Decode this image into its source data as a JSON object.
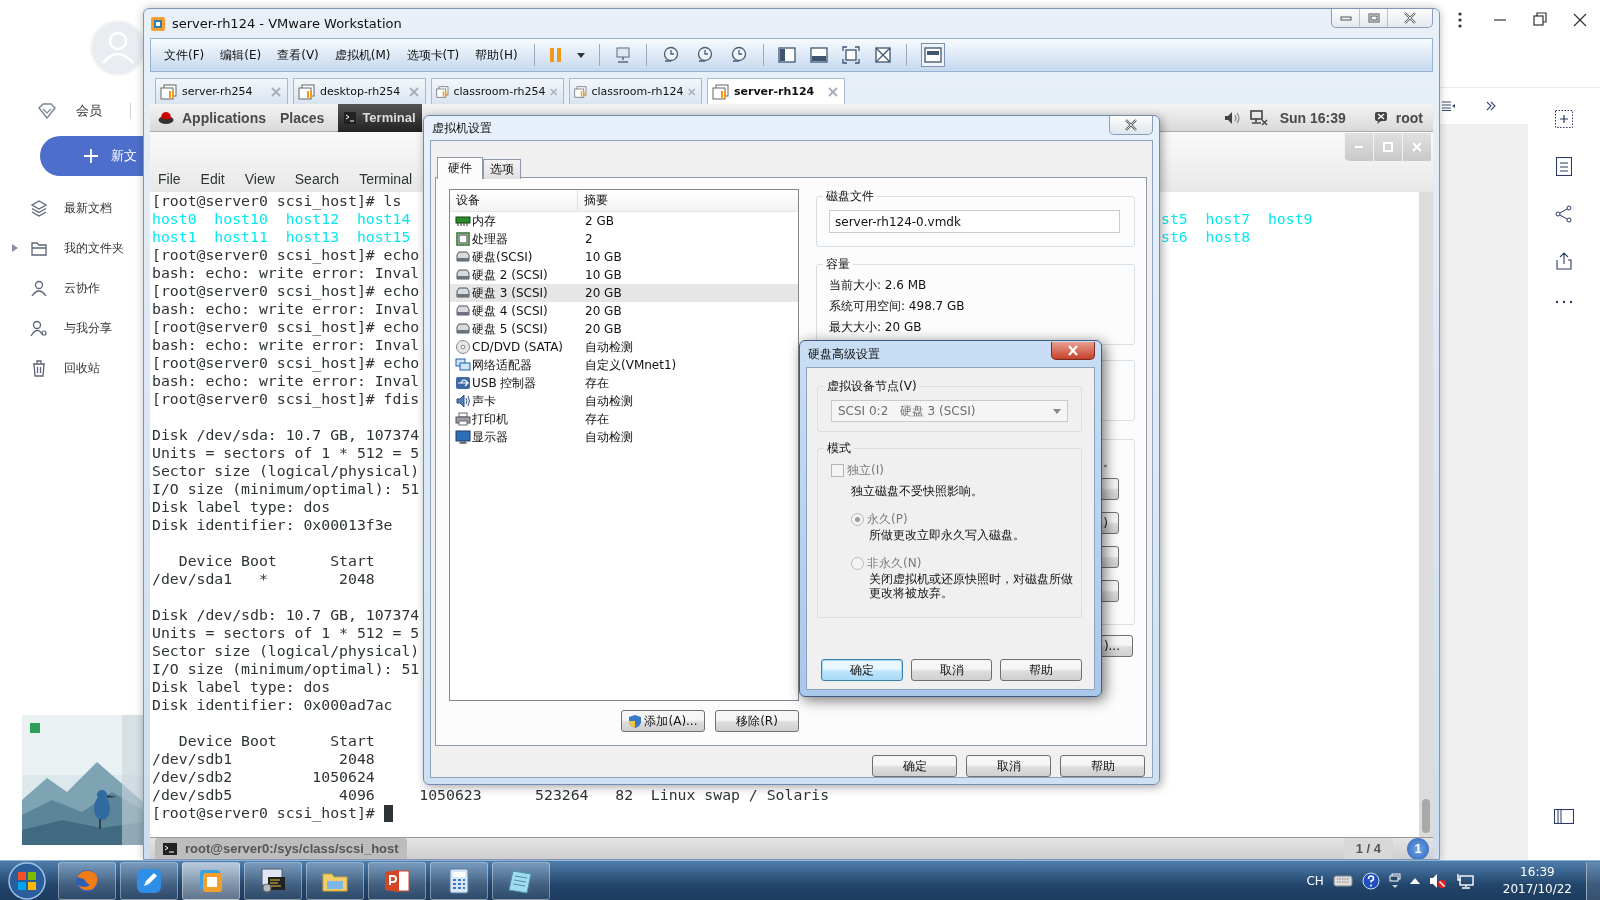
{
  "background_app": {
    "member": "会员",
    "new_button": "新文",
    "nav": [
      {
        "label": "最新文档",
        "kind": "layers",
        "expandable": false
      },
      {
        "label": "我的文件夹",
        "kind": "folder",
        "expandable": true
      },
      {
        "label": "云协作",
        "kind": "people",
        "expandable": false
      },
      {
        "label": "与我分享",
        "kind": "share",
        "expandable": false
      },
      {
        "label": "回收站",
        "kind": "trash",
        "expandable": false
      }
    ]
  },
  "vmware": {
    "title": "server-rh124 - VMware Workstation",
    "menu": [
      "文件(F)",
      "编辑(E)",
      "查看(V)",
      "虚拟机(M)",
      "选项卡(T)",
      "帮助(H)"
    ],
    "tabs": [
      {
        "label": "server-rh254",
        "selected": false
      },
      {
        "label": "desktop-rh254",
        "selected": false
      },
      {
        "label": "classroom-rh254",
        "selected": false
      },
      {
        "label": "classroom-rh124",
        "selected": false
      },
      {
        "label": "server-rh124",
        "selected": true
      }
    ],
    "guest": {
      "top_bar": {
        "applications": "Applications",
        "places": "Places",
        "window": "Terminal",
        "clock": "Sun 16:39",
        "user": "root"
      },
      "terminal": {
        "menu": [
          "File",
          "Edit",
          "View",
          "Search",
          "Terminal"
        ],
        "lines": [
          {
            "kind": "text",
            "text": "[root@server0 scsi_host]# ls"
          },
          {
            "kind": "listing",
            "text": "host0  host10  host12  host14",
            "tail": "st5  host7  host9"
          },
          {
            "kind": "listing",
            "text": "host1  host11  host13  host15",
            "tail": "st6  host8"
          },
          {
            "kind": "text",
            "text": "[root@server0 scsi_host]# echo"
          },
          {
            "kind": "text",
            "text": "bash: echo: write error: Inval"
          },
          {
            "kind": "text",
            "text": "[root@server0 scsi_host]# echo"
          },
          {
            "kind": "text",
            "text": "bash: echo: write error: Inval"
          },
          {
            "kind": "text",
            "text": "[root@server0 scsi_host]# echo"
          },
          {
            "kind": "text",
            "text": "bash: echo: write error: Inval"
          },
          {
            "kind": "text",
            "text": "[root@server0 scsi_host]# echo"
          },
          {
            "kind": "text",
            "text": "bash: echo: write error: Inval"
          },
          {
            "kind": "text",
            "text": "[root@server0 scsi_host]# fdis"
          },
          {
            "kind": "blank"
          },
          {
            "kind": "text",
            "text": "Disk /dev/sda: 10.7 GB, 107374"
          },
          {
            "kind": "text",
            "text": "Units = sectors of 1 * 512 = 5"
          },
          {
            "kind": "text",
            "text": "Sector size (logical/physical)"
          },
          {
            "kind": "text",
            "text": "I/O size (minimum/optimal): 51"
          },
          {
            "kind": "text",
            "text": "Disk label type: dos"
          },
          {
            "kind": "text",
            "text": "Disk identifier: 0x00013f3e"
          },
          {
            "kind": "blank"
          },
          {
            "kind": "text",
            "text": "   Device Boot      Start"
          },
          {
            "kind": "text",
            "text": "/dev/sda1   *        2048"
          },
          {
            "kind": "blank"
          },
          {
            "kind": "text",
            "text": "Disk /dev/sdb: 10.7 GB, 107374"
          },
          {
            "kind": "text",
            "text": "Units = sectors of 1 * 512 = 5"
          },
          {
            "kind": "text",
            "text": "Sector size (logical/physical)"
          },
          {
            "kind": "text",
            "text": "I/O size (minimum/optimal): 51"
          },
          {
            "kind": "text",
            "text": "Disk label type: dos"
          },
          {
            "kind": "text",
            "text": "Disk identifier: 0x000ad7ac"
          },
          {
            "kind": "blank"
          },
          {
            "kind": "text",
            "text": "   Device Boot      Start"
          },
          {
            "kind": "text",
            "text": "/dev/sdb1            2048"
          },
          {
            "kind": "text",
            "text": "/dev/sdb2         1050624"
          },
          {
            "kind": "text",
            "text": "/dev/sdb5            4096     1050623      523264   82  Linux swap / Solaris"
          },
          {
            "kind": "prompt",
            "text": "[root@server0 scsi_host]# "
          }
        ]
      },
      "bottom_bar": {
        "window": "root@server0:/sys/class/scsi_host",
        "workspace": "1 / 4",
        "badge": "1"
      }
    }
  },
  "settings_dialog": {
    "title": "虚拟机设置",
    "tabs": [
      {
        "label": "硬件",
        "selected": true
      },
      {
        "label": "选项",
        "selected": false
      }
    ],
    "device_columns": [
      "设备",
      "摘要"
    ],
    "devices": [
      {
        "kind": "memory",
        "name": "内存",
        "summary": "2 GB",
        "selected": false
      },
      {
        "kind": "cpu",
        "name": "处理器",
        "summary": "2",
        "selected": false
      },
      {
        "kind": "disk",
        "name": "硬盘(SCSI)",
        "summary": "10 GB",
        "selected": false
      },
      {
        "kind": "disk",
        "name": "硬盘 2 (SCSI)",
        "summary": "10 GB",
        "selected": false
      },
      {
        "kind": "disk",
        "name": "硬盘 3 (SCSI)",
        "summary": "20 GB",
        "selected": true
      },
      {
        "kind": "disk",
        "name": "硬盘 4 (SCSI)",
        "summary": "20 GB",
        "selected": false
      },
      {
        "kind": "disk",
        "name": "硬盘 5 (SCSI)",
        "summary": "20 GB",
        "selected": false
      },
      {
        "kind": "cdrom",
        "name": "CD/DVD (SATA)",
        "summary": "自动检测",
        "selected": false
      },
      {
        "kind": "network",
        "name": "网络适配器",
        "summary": "自定义(VMnet1)",
        "selected": false
      },
      {
        "kind": "usb",
        "name": "USB 控制器",
        "summary": "存在",
        "selected": false
      },
      {
        "kind": "sound",
        "name": "声卡",
        "summary": "自动检测",
        "selected": false
      },
      {
        "kind": "printer",
        "name": "打印机",
        "summary": "存在",
        "selected": false
      },
      {
        "kind": "display",
        "name": "显示器",
        "summary": "自动检测",
        "selected": false
      }
    ],
    "add_button": "添加(A)...",
    "remove_button": "移除(R)",
    "disk_file": {
      "legend": "磁盘文件",
      "value": "server-rh124-0.vmdk"
    },
    "capacity": {
      "legend": "容量",
      "lines": [
        "当前大小: 2.6 MB",
        "系统可用空间: 498.7 GB",
        "最大大小: 20 GB"
      ]
    },
    "covered": {
      "note_tail": "。",
      "group_buttons": [
        {
          "kind": "plain"
        },
        {
          "kind": "plain",
          "tail": ")"
        },
        {
          "kind": "plain"
        },
        {
          "kind": "plain"
        }
      ],
      "extra_button": ")..."
    },
    "buttons": [
      "确定",
      "取消",
      "帮助"
    ]
  },
  "advanced_dialog": {
    "title": "硬盘高级设置",
    "node": {
      "legend": "虚拟设备节点(V)",
      "value": "SCSI 0:2   硬盘 3 (SCSI)",
      "disabled": true
    },
    "mode": {
      "legend": "模式",
      "independent": {
        "label": "独立(I)",
        "checked": false,
        "disabled": true,
        "note": "独立磁盘不受快照影响。"
      },
      "options": [
        {
          "label": "永久(P)",
          "selected": true,
          "disabled": true,
          "note": "所做更改立即永久写入磁盘。"
        },
        {
          "label": "非永久(N)",
          "selected": false,
          "disabled": true,
          "note": "关闭虚拟机或还原快照时，对磁盘所做更改将被放弃。"
        }
      ]
    },
    "buttons": [
      {
        "label": "确定",
        "focused": true
      },
      {
        "label": "取消",
        "focused": false
      },
      {
        "label": "帮助",
        "focused": false
      }
    ]
  },
  "taskbar": {
    "apps": [
      {
        "kind": "browser",
        "active": false
      },
      {
        "kind": "pen",
        "active": false
      },
      {
        "kind": "vm",
        "active": true
      },
      {
        "kind": "remote",
        "active": false
      },
      {
        "kind": "folder",
        "active": false
      },
      {
        "kind": "slides",
        "active": false
      },
      {
        "kind": "calculator",
        "active": false
      },
      {
        "kind": "notepad",
        "active": false
      }
    ],
    "tray": {
      "language": "CH",
      "time": "16:39",
      "date": "2017/10/22"
    }
  }
}
